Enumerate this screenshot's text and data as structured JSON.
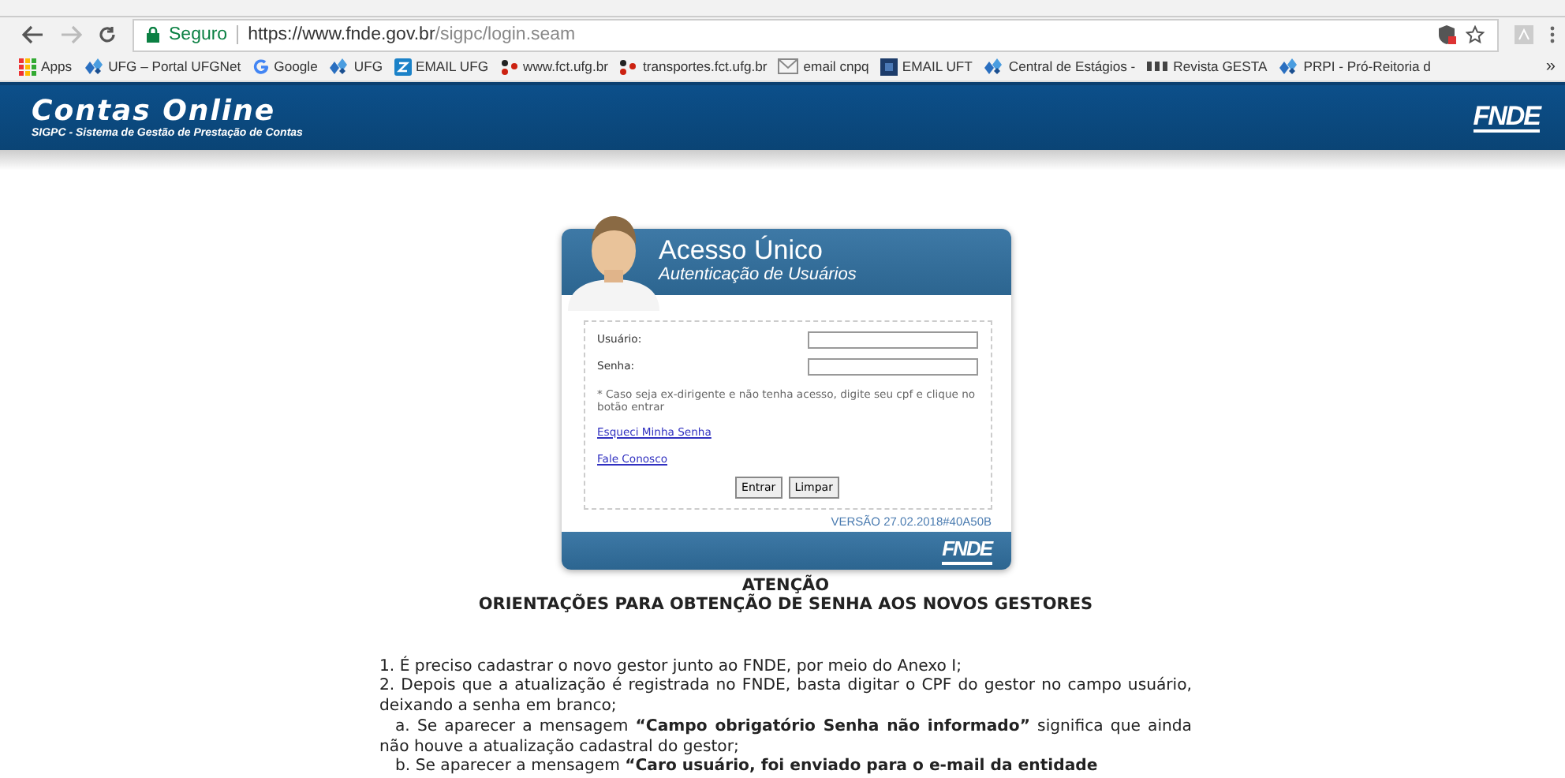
{
  "browser": {
    "security_label": "Seguro",
    "url_host": "https://www.fnde.gov.br",
    "url_path": "/sigpc/login.seam",
    "bookmarks": [
      {
        "label": "Apps",
        "kind": "apps"
      },
      {
        "label": "UFG – Portal UFGNet",
        "kind": "ufg"
      },
      {
        "label": "Google",
        "kind": "google"
      },
      {
        "label": "UFG",
        "kind": "ufg"
      },
      {
        "label": "EMAIL UFG",
        "kind": "zimbra"
      },
      {
        "label": "www.fct.ufg.br",
        "kind": "dots"
      },
      {
        "label": "transportes.fct.ufg.br",
        "kind": "dots"
      },
      {
        "label": "email cnpq",
        "kind": "mail"
      },
      {
        "label": "EMAIL UFT",
        "kind": "square"
      },
      {
        "label": "Central de Estágios -",
        "kind": "ufg"
      },
      {
        "label": "Revista GESTA",
        "kind": "pkp"
      },
      {
        "label": "PRPI - Pró-Reitoria d",
        "kind": "ufg"
      }
    ],
    "overflow": "»"
  },
  "header": {
    "title": "Contas Online",
    "subtitle": "SIGPC - Sistema de Gestão de Prestação de Contas",
    "logo": "FNDE"
  },
  "login": {
    "title": "Acesso Único",
    "subtitle": "Autenticação de Usuários",
    "fields": [
      {
        "label": "Usuário:"
      },
      {
        "label": "Senha:"
      }
    ],
    "note": "* Caso seja ex-dirigente e não tenha acesso, digite seu cpf e clique no botão entrar",
    "links": [
      "Esqueci Minha Senha",
      "Fale Conosco"
    ],
    "buttons": [
      "Entrar",
      "Limpar"
    ],
    "version": "VERSÃO 27.02.2018#40A50B",
    "footer_logo": "FNDE"
  },
  "notice": {
    "heading": "ATENÇÃO",
    "subheading": "ORIENTAÇÕES PARA OBTENÇÃO DE SENHA AOS NOVOS GESTORES",
    "items": [
      {
        "text": "1. É preciso cadastrar o novo gestor junto ao FNDE, por meio do Anexo I;",
        "indent": false
      },
      {
        "text": "2. Depois que a atualização é registrada no FNDE, basta digitar o CPF do gestor no campo usuário, deixando a senha em branco;",
        "indent": false
      },
      {
        "text": "a. Se aparecer a mensagem **“Campo obrigatório Senha não informado”** significa que ainda não houve a atualização cadastral do gestor;",
        "indent": true
      },
      {
        "text": "b. Se aparecer a mensagem **“Caro usuário, foi enviado para o e-mail da entidade**",
        "indent": true
      }
    ]
  }
}
